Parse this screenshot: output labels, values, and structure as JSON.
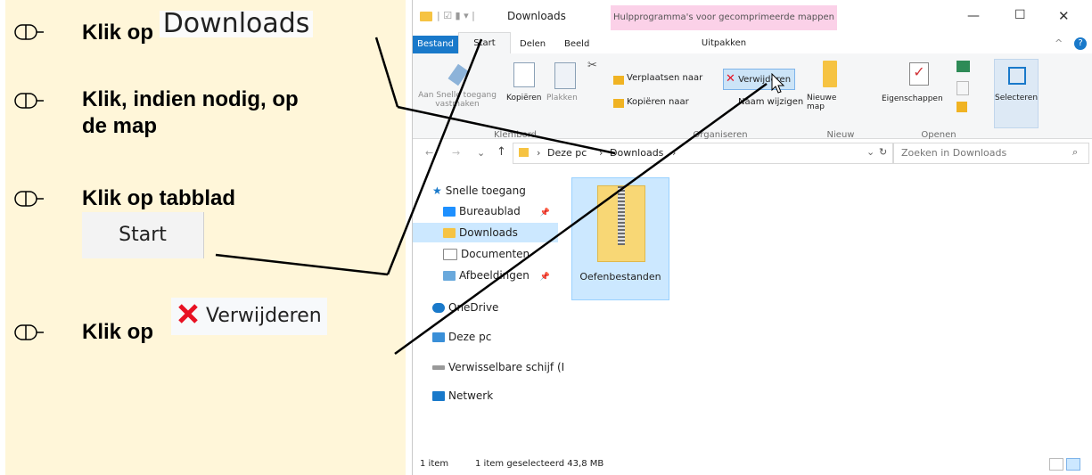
{
  "instructions": {
    "step1": {
      "prefix": "Klik op",
      "snip": "Downloads"
    },
    "step2": {
      "line1": "Klik, indien nodig, op",
      "line2": "de map"
    },
    "step3": {
      "prefix": "Klik op tabblad",
      "snip": "Start"
    },
    "step4": {
      "prefix": "Klik op",
      "snip": "Verwijderen"
    }
  },
  "window": {
    "title": "Downloads",
    "context_tab": "Hulpprogramma's voor gecomprimeerde mappen",
    "context_sub": "Uitpakken",
    "tabs": [
      "Bestand",
      "Start",
      "Delen",
      "Beeld"
    ],
    "controls": {
      "min": "—",
      "max": "☐",
      "close": "✕"
    }
  },
  "ribbon": {
    "pin_label": "Aan Snelle toegang vastmaken",
    "copy": "Kopiëren",
    "paste": "Plakken",
    "move_to": "Verplaatsen naar",
    "copy_to": "Kopiëren naar",
    "delete": "Verwijderen",
    "rename": "Naam wijzigen",
    "new_folder": "Nieuwe map",
    "properties": "Eigenschappen",
    "select": "Selecteren",
    "groups": {
      "clipboard": "Klembord",
      "organize": "Organiseren",
      "new": "Nieuw",
      "open": "Openen"
    }
  },
  "address": {
    "crumbs": [
      "Deze pc",
      "Downloads"
    ],
    "search_placeholder": "Zoeken in Downloads"
  },
  "nav": {
    "quick_access": "Snelle toegang",
    "items": [
      "Bureaublad",
      "Downloads",
      "Documenten",
      "Afbeeldingen"
    ],
    "onedrive": "OneDrive",
    "thispc": "Deze pc",
    "removable": "Verwisselbare schijf (I",
    "network": "Netwerk"
  },
  "content": {
    "folder_name": "Oefenbestanden"
  },
  "status": {
    "count": "1 item",
    "selected": "1 item geselecteerd  43,8 MB"
  },
  "colors": {
    "accent": "#1979ca",
    "paper": "#fff6d9",
    "context": "#fbd1e8",
    "selection": "#cce8ff",
    "delete_x": "#e81123"
  }
}
